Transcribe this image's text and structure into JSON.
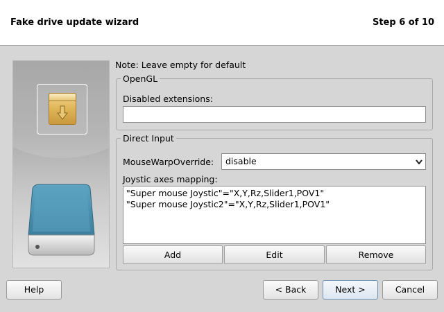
{
  "header": {
    "title": "Fake drive update wizard",
    "step": "Step 6 of 10"
  },
  "sidebar": {
    "top_icon": "package-install-icon",
    "bottom_icon": "hard-drive-icon"
  },
  "main": {
    "note": "Note: Leave empty for default",
    "opengl": {
      "legend": "OpenGL",
      "disabled_extensions_label": "Disabled extensions:",
      "disabled_extensions_value": ""
    },
    "direct_input": {
      "legend": "Direct Input",
      "mouse_warp_label": "MouseWarpOverride:",
      "mouse_warp_value": "disable",
      "axes_label": "Joystic axes mapping:",
      "axes_items": [
        "\"Super mouse Joystic\"=\"X,Y,Rz,Slider1,POV1\"",
        "\"Super mouse Joystic2\"=\"X,Y,Rz,Slider1,POV1\""
      ],
      "add_label": "Add",
      "edit_label": "Edit",
      "remove_label": "Remove"
    }
  },
  "footer": {
    "help_label": "Help",
    "back_label": "< Back",
    "next_label": "Next >",
    "cancel_label": "Cancel"
  },
  "colors": {
    "accent": "#6f8fb0",
    "drive_blue": "#4a90b0"
  }
}
